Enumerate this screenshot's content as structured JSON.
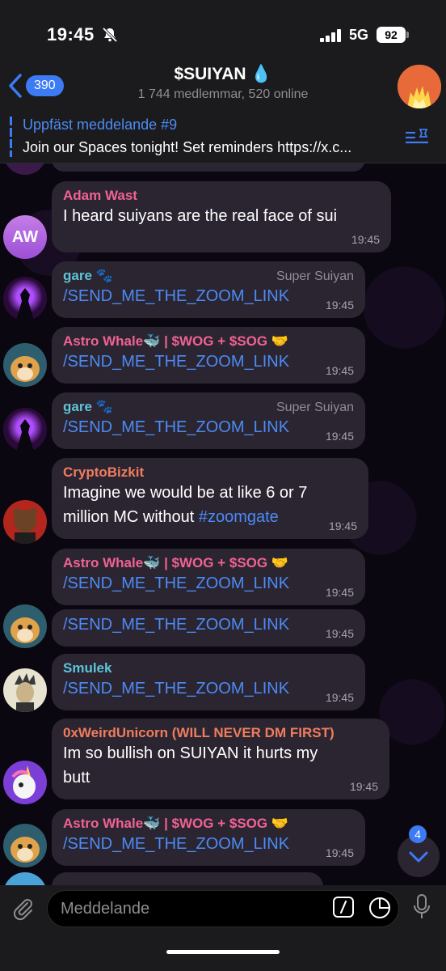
{
  "status": {
    "time": "19:45",
    "network": "5G",
    "battery": "92"
  },
  "header": {
    "back_count": "390",
    "title": "$SUIYAN 💧",
    "subtitle": "1 744 medlemmar, 520 online"
  },
  "pinned": {
    "title": "Uppfäst meddelande #9",
    "text": "Join our Spaces tonight! Set reminders https://x.c..."
  },
  "messages": [
    {
      "sender": "Adam Wast",
      "text": "I heard suiyans are the real face of sui",
      "time": "19:45",
      "avatar_initials": "AW"
    },
    {
      "sender": "gare 🐾",
      "badge": "Super Suiyan",
      "text": "/SEND_ME_THE_ZOOM_LINK",
      "time": "19:45"
    },
    {
      "sender": "Astro Whale🐳 | $WOG + $SOG 🤝",
      "text": "/SEND_ME_THE_ZOOM_LINK",
      "time": "19:45"
    },
    {
      "sender": "gare 🐾",
      "badge": "Super Suiyan",
      "text": "/SEND_ME_THE_ZOOM_LINK",
      "time": "19:45"
    },
    {
      "sender": "CryptoBizkit",
      "text_line1": "Imagine we would be at like 6 or 7",
      "text_line2": "million MC without ",
      "hashtag": "#zoomgate",
      "time": "19:45"
    },
    {
      "sender": "Astro Whale🐳 | $WOG + $SOG 🤝",
      "text": "/SEND_ME_THE_ZOOM_LINK",
      "time": "19:45"
    },
    {
      "text": "/SEND_ME_THE_ZOOM_LINK",
      "time": "19:45"
    },
    {
      "sender": "Smulek",
      "text": "/SEND_ME_THE_ZOOM_LINK",
      "time": "19:45"
    },
    {
      "sender": "0xWeirdUnicorn (WILL NEVER DM FIRST)",
      "text_line1": "Im so bullish on SUIYAN it hurts my",
      "text_line2": "butt",
      "time": "19:45"
    },
    {
      "sender": "Astro Whale🐳 | $WOG + $SOG 🤝",
      "text": "/SEND_ME_THE_ZOOM_LINK",
      "time": "19:45"
    }
  ],
  "scroll": {
    "unread_count": "4"
  },
  "input": {
    "placeholder": "Meddelande"
  },
  "colors": {
    "accent": "#3d7bf4",
    "link": "#4c8bf5",
    "bubble": "#2b2531",
    "sender_pink": "#f06292",
    "sender_cyan": "#5ec4d8",
    "sender_orange": "#ef7d5e",
    "sender_purple": "#c678dd"
  }
}
